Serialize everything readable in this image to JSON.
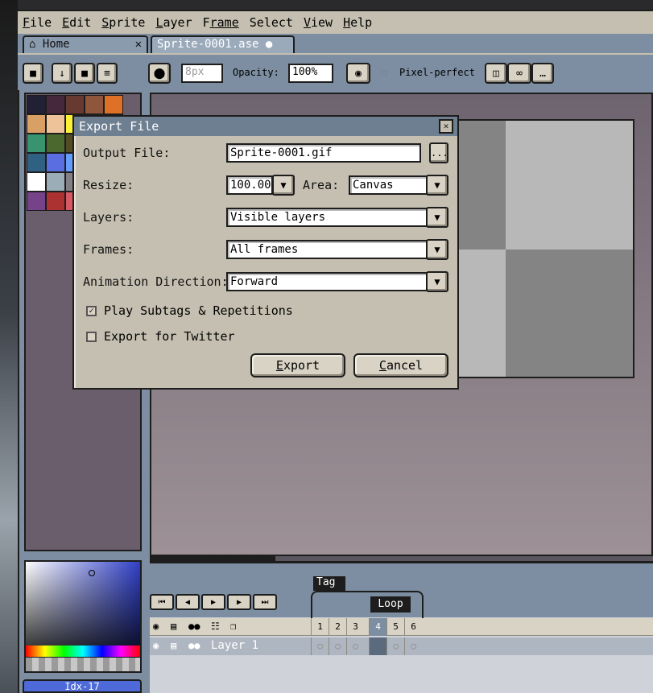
{
  "menubar": {
    "items": [
      {
        "key": "F",
        "rest": "ile"
      },
      {
        "key": "E",
        "rest": "dit"
      },
      {
        "key": "S",
        "rest": "prite"
      },
      {
        "key": "L",
        "rest": "ayer"
      },
      {
        "key": "F",
        "rest": "rame",
        "pre": ""
      },
      {
        "key": "S",
        "rest": "elect"
      },
      {
        "key": "V",
        "rest": "iew"
      },
      {
        "key": "H",
        "rest": "elp"
      }
    ]
  },
  "tabs": {
    "home": {
      "icon": "home-icon",
      "label": "Home"
    },
    "sprite": {
      "label": "Sprite-0001.ase"
    }
  },
  "toolbar": {
    "brush_size": "8px",
    "opacity_label": "Opacity:",
    "opacity_value": "100%",
    "pixel_perfect_label": "Pixel-perfect"
  },
  "palette": {
    "colors": [
      "#222034",
      "#45283c",
      "#663931",
      "#8f563b",
      "#df7126",
      "#d9a066",
      "#eec39a",
      "#fbf236",
      "#99e550",
      "#6abe30",
      "#37946e",
      "#4b692f",
      "#524b24",
      "#323c39",
      "#3f3f74",
      "#306082",
      "#5b6ee1",
      "#639bff",
      "#5fcde4",
      "#cbdbfc",
      "#ffffff",
      "#9badb7",
      "#847e87",
      "#696a6a",
      "#595652",
      "#76428a",
      "#ac3232",
      "#d95763",
      "#8f974a",
      "#8a6f30"
    ]
  },
  "color_picker": {
    "index_label": "Idx-17"
  },
  "dialog": {
    "title": "Export File",
    "output_file_label": "Output File:",
    "output_file_value": "Sprite-0001.gif",
    "browse_label": "...",
    "resize_label": "Resize:",
    "resize_value": "100.00",
    "area_label": "Area:",
    "area_value": "Canvas",
    "layers_label": "Layers:",
    "layers_value": "Visible layers",
    "frames_label": "Frames:",
    "frames_value": "All frames",
    "direction_label": "Animation Direction:",
    "direction_value": "Forward",
    "play_subtags_label": "Play Subtags & Repetitions",
    "play_subtags_checked": true,
    "export_twitter_label": "Export for Twitter",
    "export_twitter_checked": false,
    "export_button": {
      "key": "E",
      "rest": "xport"
    },
    "cancel_button": {
      "key": "C",
      "rest": "ancel"
    }
  },
  "timeline": {
    "tag_label": "Tag",
    "loop_label": "Loop",
    "frames": [
      "1",
      "2",
      "3",
      "4",
      "5",
      "6"
    ],
    "active_frame": 4,
    "layer_name": "Layer 1"
  }
}
